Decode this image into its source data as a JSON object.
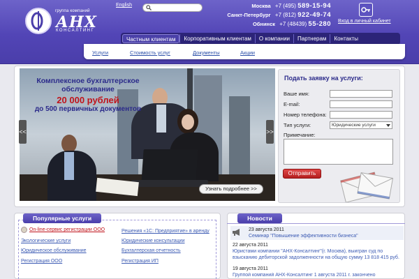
{
  "header": {
    "logo_small": "группа компаний",
    "logo_main": "АНХ",
    "logo_sub": "КОНСАЛТИНГ",
    "lang_link": "English",
    "search_placeholder": "",
    "phones": [
      {
        "city": "Москва",
        "code": "+7 (495)",
        "number": "589-15-94"
      },
      {
        "city": "Санкт-Петербург",
        "code": "+7 (812)",
        "number": "922-49-74"
      },
      {
        "city": "Обнинск",
        "code": "+7 (48439)",
        "number": "55-280"
      }
    ],
    "login_label": "Вход в личный кабинет"
  },
  "nav": {
    "items": [
      {
        "label": "Частным клиентам",
        "active": true
      },
      {
        "label": "Корпоративным клиентам"
      },
      {
        "label": "О компании"
      },
      {
        "label": "Партнерам"
      },
      {
        "label": "Контакты"
      }
    ]
  },
  "subnav": {
    "items": [
      "Услуги",
      "Стоимость услуг",
      "Документы",
      "Акции"
    ]
  },
  "banner": {
    "line1": "Комплексное бухгалтерское обслуживание",
    "line2": "20 000 рублей",
    "line3": "до 500 первичных документов",
    "more_button": "Узнать подробнее >>",
    "prev_arrow": "<<",
    "next_arrow": ">>"
  },
  "form": {
    "title": "Подать заявку на услуги:",
    "fields": {
      "name_label": "Ваше имя:",
      "email_label": "E-mail:",
      "phone_label": "Номер телефона:",
      "service_label": "Тип услуги:",
      "service_value": "Юридические услуги",
      "note_label": "Примечание:"
    },
    "submit": "Отправить"
  },
  "popular": {
    "title": "Популярные услуги",
    "col1": [
      "On-line-сервис регистрации ООО",
      "Экологические услуги",
      "Юридическое обслуживание",
      "Регистрация ООО"
    ],
    "col2": [
      "Решения «1С: Предприятие» в аренду",
      "Юридические консультации",
      "Бухгалтерская отчетность",
      "Регистрация ИП"
    ]
  },
  "news": {
    "title": "Новости",
    "items": [
      {
        "date": "23 августа 2011",
        "text": "Семинар \"Повышение эффективности бизнеса\""
      },
      {
        "date": "22 августа 2011",
        "text": "Юристами компании \"АНХ-Консалтинг\"(г. Москва), выигран суд по взысканию дебиторской задолженности на общую сумму 13 818 415 руб."
      },
      {
        "date": "19 августа 2011",
        "text": "Группой компаний АНХ-Консалтинг 1 августа 2011 г. закончено"
      }
    ]
  },
  "colors": {
    "header_purple": "#5245b6",
    "nav_dark": "#2c2478",
    "promo_blue": "#2b2a8a",
    "promo_red": "#c0141b",
    "link_blue": "#3b5ab3",
    "button_red": "#c62a2a"
  },
  "icons": [
    "search-icon",
    "key-icon",
    "megaphone-icon",
    "envelope-icon",
    "online-service-icon"
  ]
}
